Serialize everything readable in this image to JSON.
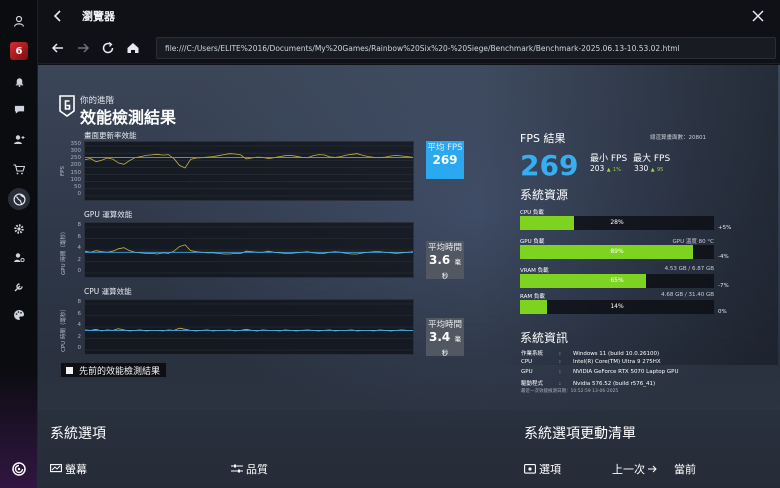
{
  "window": {
    "title": "瀏覽器"
  },
  "browser": {
    "url": "file:///C:/Users/ELITE%2016/Documents/My%20Games/Rainbow%20Six%20-%20Siege/Benchmark/Benchmark-2025.06.13-10.53.02.html"
  },
  "header": {
    "subtitle": "你的進階",
    "title": "效能檢測結果"
  },
  "sections": {
    "fps": {
      "label": "畫面更新率效能",
      "ylabel": "FPS",
      "box_label": "平均 FPS",
      "box_value": "269"
    },
    "gpu": {
      "label": "GPU 運算效能",
      "ylabel": "GPU 時間（毫秒）",
      "box_label": "平均時間",
      "box_value": "3.6",
      "box_unit": "毫秒"
    },
    "cpu": {
      "label": "CPU 運算效能",
      "ylabel": "CPU 時間（毫秒）",
      "box_label": "平均時間",
      "box_value": "3.4",
      "box_unit": "毫秒"
    }
  },
  "prev_button": {
    "label": "先前的效能檢測結果"
  },
  "fps_results": {
    "title": "FPS 結果",
    "session_label": "總渲算畫面數：20801",
    "avg": "269",
    "min_label": "最小 FPS",
    "max_label": "最大 FPS",
    "min": "203",
    "min_pct": "1%",
    "max": "330",
    "max_pct": "95"
  },
  "resources": {
    "title": "系統資源",
    "items": [
      {
        "label": "CPU 負載",
        "value": 28,
        "pct": "28%",
        "info": "",
        "delta": "+5%"
      },
      {
        "label": "GPU 負載",
        "value": 89,
        "pct": "89%",
        "info": "GPU 溫度 80 °C",
        "delta": "-4%"
      },
      {
        "label": "VRAM 負載",
        "value": 65,
        "pct": "65%",
        "info": "4.53 GB / 6.87 GB",
        "delta": "-7%"
      },
      {
        "label": "RAM 負載",
        "value": 14,
        "pct": "14%",
        "info": "4.68 GB / 31.40 GB",
        "delta": "0%"
      }
    ]
  },
  "system_info": {
    "title": "系統資訊",
    "rows": [
      {
        "key": "作業系統",
        "value": "Windows 11 (build 10.0.26100)"
      },
      {
        "key": "CPU",
        "value": "Intel(R) Core(TM) Ultra 9 275HX"
      },
      {
        "key": "GPU",
        "value": "NVIDIA GeForce RTX 5070 Laptop GPU"
      },
      {
        "key": "驅動程式",
        "value": "Nvidia 576.52 (build r576_41)"
      }
    ],
    "note": "最近一次效能檢測日期：10:52:59 13-06-2025"
  },
  "bottom": {
    "options_title": "系統選項",
    "changes_title": "系統選項更動清單",
    "screen_cat": "螢幕",
    "quality_cat": "品質",
    "options_cat": "選項",
    "prev_label": "上一次",
    "current_label": "當前"
  },
  "chart_data": [
    {
      "type": "line",
      "x": [
        0,
        1,
        2,
        3,
        4,
        5,
        6,
        7,
        8,
        9,
        10,
        11,
        12,
        13,
        14,
        15,
        16,
        17,
        18,
        19,
        20,
        21,
        22,
        23,
        24,
        25,
        26,
        27,
        28,
        29,
        30,
        31,
        32,
        33,
        34,
        35,
        36,
        37,
        38,
        39,
        40,
        41,
        42,
        43,
        44,
        45,
        46,
        47,
        48,
        49,
        50,
        51,
        52,
        53,
        54,
        55,
        56,
        57,
        58,
        59
      ],
      "series": [
        {
          "values": [
            255,
            262,
            240,
            250,
            266,
            258,
            232,
            222,
            248,
            268,
            276,
            284,
            288,
            292,
            286,
            290,
            262,
            214,
            196,
            256,
            266,
            268,
            272,
            276,
            282,
            290,
            296,
            294,
            288,
            260,
            266,
            272,
            270,
            262,
            268,
            276,
            282,
            284,
            278,
            270,
            268,
            282,
            290,
            288,
            274,
            270,
            276,
            286,
            292,
            296,
            284,
            276,
            270,
            268,
            272,
            280,
            284,
            280,
            276,
            270
          ]
        },
        {
          "values": [
            269,
            269,
            269,
            269,
            269,
            269,
            269,
            269,
            269,
            269,
            269,
            269,
            269,
            269,
            269,
            269,
            269,
            269,
            269,
            269,
            269,
            269,
            269,
            269,
            269,
            269,
            269,
            269,
            269,
            269,
            269,
            269,
            269,
            269,
            269,
            269,
            269,
            269,
            269,
            269,
            269,
            269,
            269,
            269,
            269,
            269,
            269,
            269,
            269,
            269,
            269,
            269,
            269,
            269,
            269,
            269,
            269,
            269,
            269,
            269
          ]
        }
      ],
      "ylim": [
        0,
        350
      ],
      "yticks": [
        0,
        50,
        100,
        150,
        200,
        250,
        300,
        350
      ]
    },
    {
      "type": "line",
      "x": [
        0,
        1,
        2,
        3,
        4,
        5,
        6,
        7,
        8,
        9,
        10,
        11,
        12,
        13,
        14,
        15,
        16,
        17,
        18,
        19,
        20,
        21,
        22,
        23,
        24,
        25,
        26,
        27,
        28,
        29,
        30,
        31,
        32,
        33,
        34,
        35,
        36,
        37,
        38,
        39,
        40,
        41,
        42,
        43,
        44,
        45,
        46,
        47,
        48,
        49,
        50,
        51,
        52,
        53,
        54,
        55,
        56,
        57,
        58,
        59
      ],
      "series": [
        {
          "values": [
            3.8,
            3.6,
            3.9,
            3.7,
            3.6,
            3.8,
            4.2,
            4.4,
            3.9,
            3.6,
            3.5,
            3.4,
            3.4,
            3.3,
            3.5,
            3.4,
            3.8,
            4.6,
            4.9,
            3.9,
            3.7,
            3.6,
            3.5,
            3.5,
            3.4,
            3.3,
            3.3,
            3.4,
            3.4,
            3.8,
            3.7,
            3.6,
            3.6,
            3.8,
            3.6,
            3.5,
            3.4,
            3.4,
            3.5,
            3.6,
            3.7,
            3.5,
            3.4,
            3.4,
            3.6,
            3.7,
            3.6,
            3.4,
            3.3,
            3.3,
            3.5,
            3.6,
            3.7,
            3.7,
            3.6,
            3.5,
            3.4,
            3.5,
            3.6,
            3.7
          ]
        },
        {
          "values": [
            3.6,
            3.6,
            3.6,
            3.6,
            3.6,
            3.6,
            3.6,
            3.6,
            3.6,
            3.6,
            3.6,
            3.6,
            3.6,
            3.6,
            3.6,
            3.6,
            3.6,
            3.6,
            3.6,
            3.6,
            3.6,
            3.6,
            3.6,
            3.6,
            3.6,
            3.6,
            3.6,
            3.6,
            3.6,
            3.6,
            3.6,
            3.6,
            3.6,
            3.6,
            3.6,
            3.6,
            3.6,
            3.6,
            3.6,
            3.6,
            3.6,
            3.6,
            3.6,
            3.6,
            3.6,
            3.6,
            3.6,
            3.6,
            3.6,
            3.6,
            3.6,
            3.6,
            3.6,
            3.6,
            3.6,
            3.6,
            3.6,
            3.6,
            3.6,
            3.6
          ]
        }
      ],
      "ylim": [
        0,
        8
      ],
      "yticks": [
        0,
        2,
        4,
        6,
        8
      ]
    },
    {
      "type": "line",
      "x": [
        0,
        1,
        2,
        3,
        4,
        5,
        6,
        7,
        8,
        9,
        10,
        11,
        12,
        13,
        14,
        15,
        16,
        17,
        18,
        19,
        20,
        21,
        22,
        23,
        24,
        25,
        26,
        27,
        28,
        29,
        30,
        31,
        32,
        33,
        34,
        35,
        36,
        37,
        38,
        39,
        40,
        41,
        42,
        43,
        44,
        45,
        46,
        47,
        48,
        49,
        50,
        51,
        52,
        53,
        54,
        55,
        56,
        57,
        58,
        59
      ],
      "series": [
        {
          "values": [
            3.5,
            3.4,
            3.6,
            3.3,
            3.5,
            3.4,
            3.7,
            3.5,
            3.3,
            3.4,
            3.5,
            3.3,
            3.4,
            3.4,
            3.3,
            3.5,
            3.4,
            3.8,
            3.6,
            3.4,
            3.3,
            3.4,
            3.5,
            3.3,
            3.4,
            3.4,
            3.5,
            3.3,
            3.4,
            3.6,
            3.4,
            3.3,
            3.5,
            3.4,
            3.4,
            3.3,
            3.5,
            3.4,
            3.3,
            3.4,
            3.5,
            3.4,
            3.3,
            3.4,
            3.5,
            3.3,
            3.4,
            3.4,
            3.5,
            3.3,
            3.4,
            3.4,
            3.3,
            3.5,
            3.4,
            3.3,
            3.4,
            3.5,
            3.4,
            3.4
          ]
        },
        {
          "values": [
            3.4,
            3.4,
            3.4,
            3.4,
            3.4,
            3.4,
            3.4,
            3.4,
            3.4,
            3.4,
            3.4,
            3.4,
            3.4,
            3.4,
            3.4,
            3.4,
            3.4,
            3.4,
            3.4,
            3.4,
            3.4,
            3.4,
            3.4,
            3.4,
            3.4,
            3.4,
            3.4,
            3.4,
            3.4,
            3.4,
            3.4,
            3.4,
            3.4,
            3.4,
            3.4,
            3.4,
            3.4,
            3.4,
            3.4,
            3.4,
            3.4,
            3.4,
            3.4,
            3.4,
            3.4,
            3.4,
            3.4,
            3.4,
            3.4,
            3.4,
            3.4,
            3.4,
            3.4,
            3.4,
            3.4,
            3.4,
            3.4,
            3.4,
            3.4,
            3.4
          ]
        }
      ],
      "ylim": [
        0,
        8
      ],
      "yticks": [
        0,
        2,
        4,
        6,
        8
      ]
    }
  ],
  "colors": {
    "accent": "#2aa8f0",
    "bar": "#7ed321",
    "line": "#c8b23a",
    "avg_line": "#3fa8ee"
  }
}
